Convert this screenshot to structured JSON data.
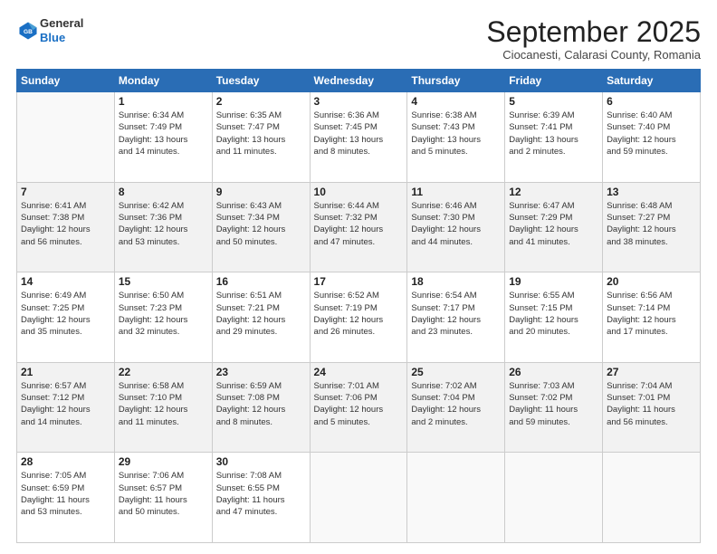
{
  "logo": {
    "general": "General",
    "blue": "Blue"
  },
  "title": "September 2025",
  "location": "Ciocanesti, Calarasi County, Romania",
  "days_header": [
    "Sunday",
    "Monday",
    "Tuesday",
    "Wednesday",
    "Thursday",
    "Friday",
    "Saturday"
  ],
  "weeks": [
    [
      {
        "day": "",
        "detail": ""
      },
      {
        "day": "1",
        "detail": "Sunrise: 6:34 AM\nSunset: 7:49 PM\nDaylight: 13 hours\nand 14 minutes."
      },
      {
        "day": "2",
        "detail": "Sunrise: 6:35 AM\nSunset: 7:47 PM\nDaylight: 13 hours\nand 11 minutes."
      },
      {
        "day": "3",
        "detail": "Sunrise: 6:36 AM\nSunset: 7:45 PM\nDaylight: 13 hours\nand 8 minutes."
      },
      {
        "day": "4",
        "detail": "Sunrise: 6:38 AM\nSunset: 7:43 PM\nDaylight: 13 hours\nand 5 minutes."
      },
      {
        "day": "5",
        "detail": "Sunrise: 6:39 AM\nSunset: 7:41 PM\nDaylight: 13 hours\nand 2 minutes."
      },
      {
        "day": "6",
        "detail": "Sunrise: 6:40 AM\nSunset: 7:40 PM\nDaylight: 12 hours\nand 59 minutes."
      }
    ],
    [
      {
        "day": "7",
        "detail": "Sunrise: 6:41 AM\nSunset: 7:38 PM\nDaylight: 12 hours\nand 56 minutes."
      },
      {
        "day": "8",
        "detail": "Sunrise: 6:42 AM\nSunset: 7:36 PM\nDaylight: 12 hours\nand 53 minutes."
      },
      {
        "day": "9",
        "detail": "Sunrise: 6:43 AM\nSunset: 7:34 PM\nDaylight: 12 hours\nand 50 minutes."
      },
      {
        "day": "10",
        "detail": "Sunrise: 6:44 AM\nSunset: 7:32 PM\nDaylight: 12 hours\nand 47 minutes."
      },
      {
        "day": "11",
        "detail": "Sunrise: 6:46 AM\nSunset: 7:30 PM\nDaylight: 12 hours\nand 44 minutes."
      },
      {
        "day": "12",
        "detail": "Sunrise: 6:47 AM\nSunset: 7:29 PM\nDaylight: 12 hours\nand 41 minutes."
      },
      {
        "day": "13",
        "detail": "Sunrise: 6:48 AM\nSunset: 7:27 PM\nDaylight: 12 hours\nand 38 minutes."
      }
    ],
    [
      {
        "day": "14",
        "detail": "Sunrise: 6:49 AM\nSunset: 7:25 PM\nDaylight: 12 hours\nand 35 minutes."
      },
      {
        "day": "15",
        "detail": "Sunrise: 6:50 AM\nSunset: 7:23 PM\nDaylight: 12 hours\nand 32 minutes."
      },
      {
        "day": "16",
        "detail": "Sunrise: 6:51 AM\nSunset: 7:21 PM\nDaylight: 12 hours\nand 29 minutes."
      },
      {
        "day": "17",
        "detail": "Sunrise: 6:52 AM\nSunset: 7:19 PM\nDaylight: 12 hours\nand 26 minutes."
      },
      {
        "day": "18",
        "detail": "Sunrise: 6:54 AM\nSunset: 7:17 PM\nDaylight: 12 hours\nand 23 minutes."
      },
      {
        "day": "19",
        "detail": "Sunrise: 6:55 AM\nSunset: 7:15 PM\nDaylight: 12 hours\nand 20 minutes."
      },
      {
        "day": "20",
        "detail": "Sunrise: 6:56 AM\nSunset: 7:14 PM\nDaylight: 12 hours\nand 17 minutes."
      }
    ],
    [
      {
        "day": "21",
        "detail": "Sunrise: 6:57 AM\nSunset: 7:12 PM\nDaylight: 12 hours\nand 14 minutes."
      },
      {
        "day": "22",
        "detail": "Sunrise: 6:58 AM\nSunset: 7:10 PM\nDaylight: 12 hours\nand 11 minutes."
      },
      {
        "day": "23",
        "detail": "Sunrise: 6:59 AM\nSunset: 7:08 PM\nDaylight: 12 hours\nand 8 minutes."
      },
      {
        "day": "24",
        "detail": "Sunrise: 7:01 AM\nSunset: 7:06 PM\nDaylight: 12 hours\nand 5 minutes."
      },
      {
        "day": "25",
        "detail": "Sunrise: 7:02 AM\nSunset: 7:04 PM\nDaylight: 12 hours\nand 2 minutes."
      },
      {
        "day": "26",
        "detail": "Sunrise: 7:03 AM\nSunset: 7:02 PM\nDaylight: 11 hours\nand 59 minutes."
      },
      {
        "day": "27",
        "detail": "Sunrise: 7:04 AM\nSunset: 7:01 PM\nDaylight: 11 hours\nand 56 minutes."
      }
    ],
    [
      {
        "day": "28",
        "detail": "Sunrise: 7:05 AM\nSunset: 6:59 PM\nDaylight: 11 hours\nand 53 minutes."
      },
      {
        "day": "29",
        "detail": "Sunrise: 7:06 AM\nSunset: 6:57 PM\nDaylight: 11 hours\nand 50 minutes."
      },
      {
        "day": "30",
        "detail": "Sunrise: 7:08 AM\nSunset: 6:55 PM\nDaylight: 11 hours\nand 47 minutes."
      },
      {
        "day": "",
        "detail": ""
      },
      {
        "day": "",
        "detail": ""
      },
      {
        "day": "",
        "detail": ""
      },
      {
        "day": "",
        "detail": ""
      }
    ]
  ]
}
